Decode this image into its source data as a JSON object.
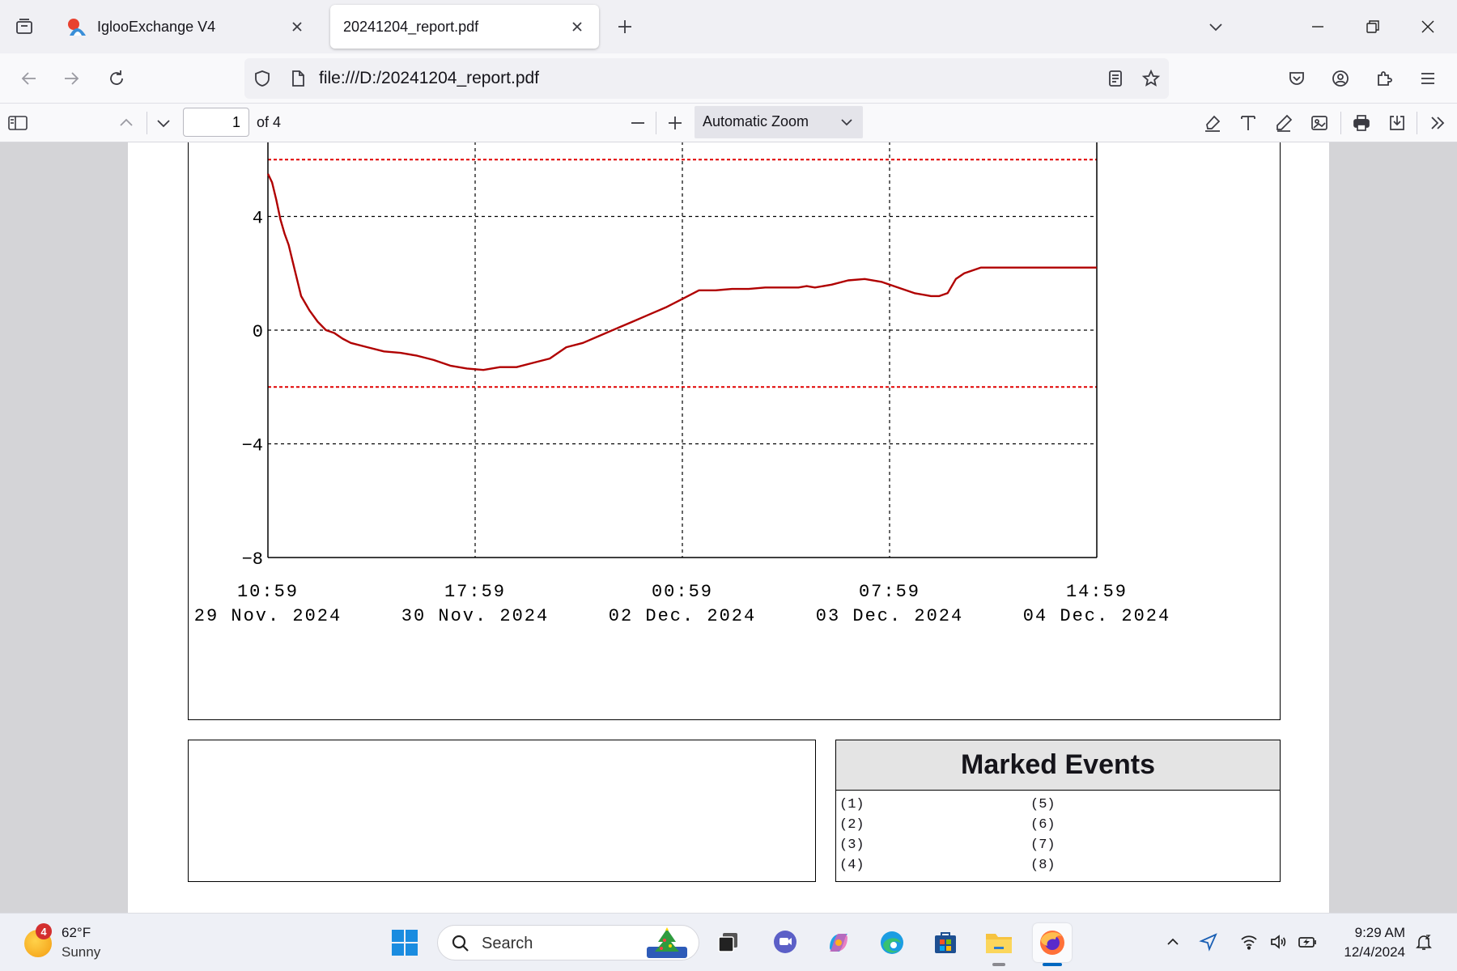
{
  "browser": {
    "tabs": [
      {
        "title": "IglooExchange V4",
        "active": false
      },
      {
        "title": "20241204_report.pdf",
        "active": true
      }
    ],
    "url": "file:///D:/20241204_report.pdf"
  },
  "pdf_toolbar": {
    "page_number": "1",
    "page_count": "of 4",
    "zoom": "Automatic Zoom"
  },
  "chart_data": {
    "type": "line",
    "title": "",
    "xlabel": "",
    "ylabel": "",
    "ylim": [
      -8,
      8
    ],
    "xlim": [
      0,
      100
    ],
    "grid": true,
    "x_tick_labels": [
      {
        "time": "10:59",
        "date": "29 Nov. 2024"
      },
      {
        "time": "17:59",
        "date": "30 Nov. 2024"
      },
      {
        "time": "00:59",
        "date": "02 Dec. 2024"
      },
      {
        "time": "07:59",
        "date": "03 Dec. 2024"
      },
      {
        "time": "14:59",
        "date": "04 Dec. 2024"
      }
    ],
    "y_ticks": [
      4,
      0,
      -4,
      -8
    ],
    "thresholds": [
      6,
      -2
    ],
    "series": [
      {
        "color": "#b00000",
        "x": [
          0,
          0.5,
          1,
          1.5,
          2,
          2.5,
          3,
          4,
          5,
          6,
          7,
          8,
          9,
          10,
          12,
          14,
          16,
          18,
          20,
          22,
          24,
          26,
          28,
          30,
          32,
          34,
          36,
          38,
          40,
          42,
          44,
          46,
          48,
          50,
          52,
          54,
          56,
          58,
          60,
          62,
          64,
          65,
          66,
          68,
          70,
          72,
          74,
          76,
          78,
          80,
          81,
          82,
          83,
          84,
          85,
          86,
          87,
          88,
          89,
          90,
          91,
          92,
          93,
          94,
          100
        ],
        "values": [
          5.5,
          5.2,
          4.6,
          3.9,
          3.4,
          3.0,
          2.4,
          1.2,
          0.7,
          0.3,
          0.0,
          -0.1,
          -0.3,
          -0.45,
          -0.6,
          -0.75,
          -0.8,
          -0.9,
          -1.05,
          -1.25,
          -1.35,
          -1.4,
          -1.3,
          -1.3,
          -1.15,
          -1.0,
          -0.6,
          -0.45,
          -0.2,
          0.05,
          0.3,
          0.55,
          0.8,
          1.1,
          1.4,
          1.4,
          1.45,
          1.45,
          1.5,
          1.5,
          1.5,
          1.55,
          1.5,
          1.6,
          1.75,
          1.8,
          1.7,
          1.5,
          1.3,
          1.2,
          1.2,
          1.3,
          1.8,
          2.0,
          2.1,
          2.2,
          2.2,
          2.2,
          2.2,
          2.2,
          2.2,
          2.2,
          2.2,
          2.2,
          2.2
        ]
      }
    ]
  },
  "marked_events": {
    "title": "Marked Events",
    "items": [
      "(1)",
      "(2)",
      "(3)",
      "(4)",
      "(5)",
      "(6)",
      "(7)",
      "(8)"
    ]
  },
  "taskbar": {
    "weather": {
      "temp": "62°F",
      "condition": "Sunny",
      "badge": "4"
    },
    "search_placeholder": "Search",
    "time": "9:29 AM",
    "date": "12/4/2024"
  }
}
